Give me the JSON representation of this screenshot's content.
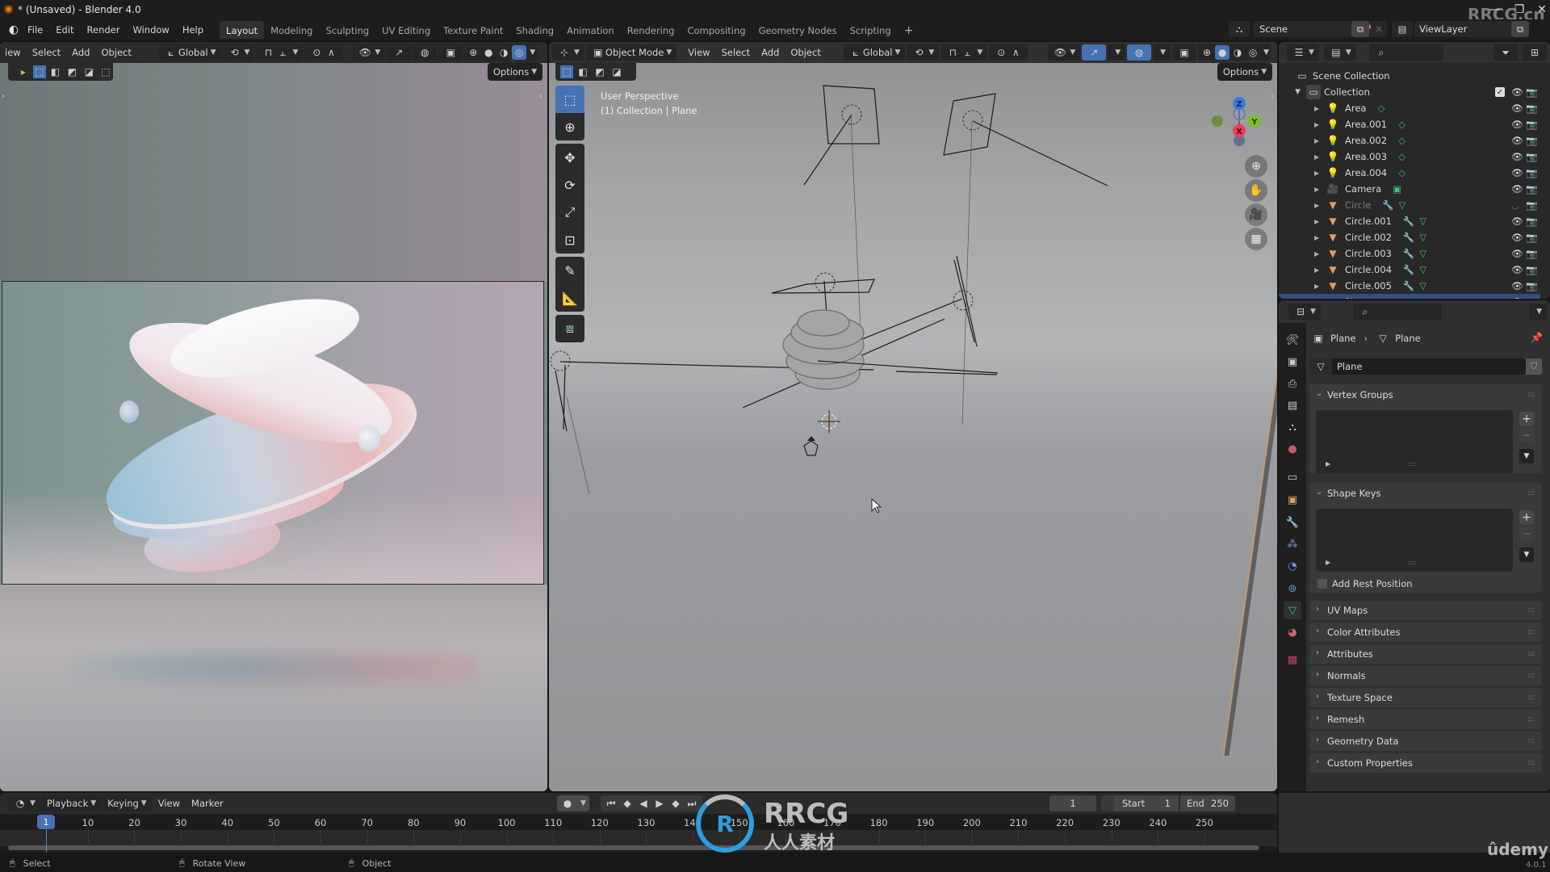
{
  "window": {
    "title": "* (Unsaved) - Blender 4.0",
    "controls": [
      "minimize",
      "maximize",
      "close"
    ]
  },
  "menu": {
    "items": [
      "File",
      "Edit",
      "Render",
      "Window",
      "Help"
    ]
  },
  "workspaces": {
    "active": "Layout",
    "tabs": [
      "Layout",
      "Modeling",
      "Sculpting",
      "UV Editing",
      "Texture Paint",
      "Shading",
      "Animation",
      "Rendering",
      "Compositing",
      "Geometry Nodes",
      "Scripting"
    ],
    "add_label": "+"
  },
  "scene": {
    "label": "Scene"
  },
  "view_layer": {
    "label": "ViewLayer"
  },
  "left_editor": {
    "menus": [
      "iew",
      "Select",
      "Add",
      "Object"
    ],
    "orientation": "Global",
    "options_label": "Options",
    "shading_active": "rendered"
  },
  "viewport": {
    "mode": "Object Mode",
    "menus": [
      "View",
      "Select",
      "Add",
      "Object"
    ],
    "orientation": "Global",
    "options_label": "Options",
    "overlay_line1": "User Perspective",
    "overlay_line2": "(1) Collection | Plane",
    "shading_active": "solid",
    "tools": [
      "select-box",
      "cursor",
      "move",
      "rotate",
      "scale",
      "transform",
      "annotate",
      "measure",
      "add-cube"
    ],
    "gizmo_axes": [
      "X",
      "Y",
      "Z"
    ],
    "nav": [
      "zoom",
      "pan",
      "camera",
      "grid"
    ]
  },
  "outliner": {
    "root": "Scene Collection",
    "collection": "Collection",
    "items": [
      {
        "name": "Area",
        "type": "light",
        "extra": "light-data"
      },
      {
        "name": "Area.001",
        "type": "light",
        "extra": "light-data"
      },
      {
        "name": "Area.002",
        "type": "light",
        "extra": "light-data"
      },
      {
        "name": "Area.003",
        "type": "light",
        "extra": "light-data"
      },
      {
        "name": "Area.004",
        "type": "light",
        "extra": "light-data"
      },
      {
        "name": "Camera",
        "type": "camera",
        "extra": "camera-data"
      },
      {
        "name": "Circle",
        "type": "mesh",
        "extra": "modifier+mesh",
        "hidden": true
      },
      {
        "name": "Circle.001",
        "type": "mesh",
        "extra": "modifier+mesh"
      },
      {
        "name": "Circle.002",
        "type": "mesh",
        "extra": "modifier+mesh"
      },
      {
        "name": "Circle.003",
        "type": "mesh",
        "extra": "modifier+mesh"
      },
      {
        "name": "Circle.004",
        "type": "mesh",
        "extra": "modifier+mesh"
      },
      {
        "name": "Circle.005",
        "type": "mesh",
        "extra": "modifier+mesh"
      },
      {
        "name": "Plane",
        "type": "mesh",
        "extra": "mesh",
        "selected": true
      }
    ]
  },
  "properties": {
    "breadcrumb": [
      "Plane",
      "Plane"
    ],
    "datablock": "Plane",
    "panels_open": [
      {
        "title": "Vertex Groups"
      },
      {
        "title": "Shape Keys",
        "checkbox": "Add Rest Position"
      }
    ],
    "panels_closed": [
      "UV Maps",
      "Color Attributes",
      "Attributes",
      "Normals",
      "Texture Space",
      "Remesh",
      "Geometry Data",
      "Custom Properties"
    ],
    "active_tab": "mesh-data"
  },
  "timeline": {
    "menus": [
      "Playback",
      "Keying",
      "View",
      "Marker"
    ],
    "current_frame": "1",
    "start_label": "Start",
    "start": "1",
    "end_label": "End",
    "end": "250",
    "ticks": [
      "10",
      "20",
      "30",
      "40",
      "50",
      "60",
      "70",
      "80",
      "90",
      "100",
      "110",
      "120",
      "130",
      "140",
      "150",
      "160",
      "170",
      "180",
      "190",
      "200",
      "210",
      "220",
      "230",
      "240",
      "250"
    ],
    "playhead_label": "1"
  },
  "statusbar": {
    "items": [
      "Select",
      "Rotate View",
      "Object"
    ],
    "version": "4.0.1"
  },
  "watermarks": {
    "top_right": "RRCG.cn",
    "center_title": "RRCG",
    "center_sub": "人人素材",
    "bottom_right": "ûdemy"
  },
  "colors": {
    "accent_blue": "#4772b3",
    "selection": "#334d80",
    "mesh_green": "#3fbf7f",
    "light_orange": "#e89a5a"
  }
}
